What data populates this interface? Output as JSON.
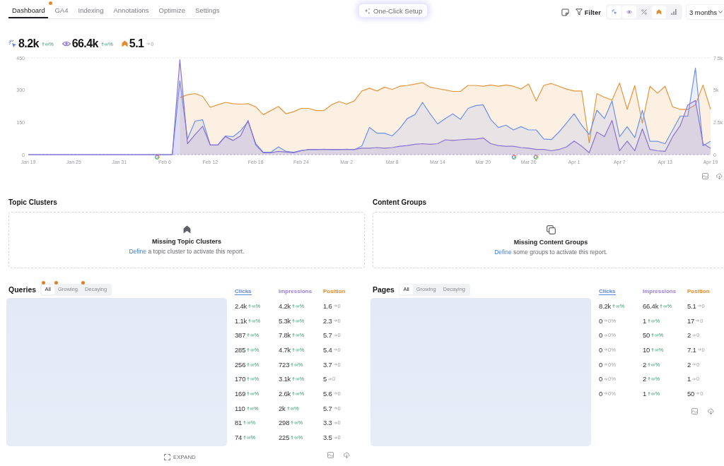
{
  "tabs": [
    {
      "label": "Dashboard",
      "selected": true,
      "dot": false
    },
    {
      "label": "GA4",
      "selected": false,
      "dot": true
    },
    {
      "label": "Indexing",
      "selected": false,
      "dot": false
    },
    {
      "label": "Annotations",
      "selected": false,
      "dot": false
    },
    {
      "label": "Optimize",
      "selected": false,
      "dot": false
    },
    {
      "label": "Settings",
      "selected": false,
      "dot": false
    }
  ],
  "setup_button": {
    "label": "One-Click Setup"
  },
  "toolbar": {
    "filter_label": "Filter",
    "metric_toggles": [
      {
        "kind": "clicks",
        "selected": true
      },
      {
        "kind": "impressions",
        "selected": true
      },
      {
        "kind": "ctr",
        "selected": false
      },
      {
        "kind": "position",
        "selected": true
      },
      {
        "kind": "bars",
        "selected": false
      }
    ],
    "range": "3 months"
  },
  "summary": [
    {
      "kind": "clicks",
      "value": "8.2k",
      "change": "∞%",
      "rising": true
    },
    {
      "kind": "impressions",
      "value": "66.4k",
      "change": "∞%",
      "rising": true
    },
    {
      "kind": "position",
      "value": "5.1",
      "change": "0",
      "rising": false
    }
  ],
  "chart": {
    "chart_data": {
      "type": "area",
      "categories": [
        "Jan 19",
        null,
        null,
        null,
        null,
        null,
        "Jan 25",
        null,
        null,
        null,
        null,
        null,
        "Jan 31",
        null,
        null,
        null,
        null,
        null,
        "Feb 6",
        null,
        null,
        null,
        null,
        null,
        "Feb 12",
        null,
        null,
        null,
        null,
        null,
        "Feb 18",
        null,
        null,
        null,
        null,
        null,
        "Feb 24",
        null,
        null,
        null,
        null,
        null,
        "Mar 2",
        null,
        null,
        null,
        null,
        null,
        "Mar 8",
        null,
        null,
        null,
        null,
        null,
        "Mar 14",
        null,
        null,
        null,
        null,
        null,
        "Mar 20",
        null,
        null,
        null,
        null,
        null,
        "Mar 26",
        null,
        null,
        null,
        null,
        null,
        "Apr 1",
        null,
        null,
        null,
        null,
        null,
        "Apr 7",
        null,
        null,
        null,
        null,
        null,
        "Apr 13",
        null,
        null,
        null,
        null,
        null,
        "Apr 19"
      ],
      "ylim": [
        0,
        450
      ],
      "yticks": [
        0,
        150,
        300,
        450
      ],
      "y2lim": [
        0,
        7500
      ],
      "y2ticks": [
        {
          "value": 0,
          "label": "0"
        },
        {
          "value": 2500,
          "label": "2.5k"
        },
        {
          "value": 5000,
          "label": "5k"
        },
        {
          "value": 7500,
          "label": "7.5k"
        }
      ],
      "series": [
        {
          "color": "#e8953c",
          "values": [
            null,
            null,
            null,
            null,
            null,
            null,
            null,
            null,
            null,
            null,
            null,
            null,
            null,
            null,
            null,
            null,
            null,
            null,
            null,
            null,
            265,
            279,
            284,
            271,
            220,
            232,
            243,
            237,
            235,
            237,
            222,
            186,
            205,
            224,
            190,
            200,
            215,
            215,
            205,
            205,
            232,
            247,
            235,
            250,
            296,
            309,
            296,
            314,
            303,
            318,
            322,
            328,
            335,
            314,
            307,
            301,
            294,
            294,
            322,
            322,
            318,
            324,
            318,
            324,
            318,
            305,
            328,
            250,
            322,
            331,
            318,
            305,
            296,
            296,
            55,
            284,
            267,
            254,
            333,
            211,
            322,
            147,
            318,
            286,
            318,
            222,
            211,
            211,
            232,
            324,
            211
          ]
        },
        {
          "color": "#6f92e8",
          "values": [
            0,
            0,
            0,
            0,
            0,
            0,
            0,
            0,
            0,
            0,
            0,
            0,
            0,
            0,
            0,
            0,
            0,
            0,
            0,
            0,
            343,
            73,
            156,
            162,
            45,
            45,
            87,
            83,
            111,
            154,
            51,
            11,
            11,
            36,
            15,
            11,
            19,
            23,
            23,
            25,
            23,
            23,
            25,
            23,
            40,
            126,
            100,
            100,
            87,
            122,
            168,
            186,
            243,
            190,
            143,
            168,
            190,
            164,
            215,
            228,
            232,
            164,
            126,
            137,
            115,
            130,
            115,
            115,
            73,
            70,
            105,
            147,
            190,
            137,
            94,
            207,
            168,
            250,
            83,
            130,
            79,
            207,
            62,
            62,
            51,
            115,
            179,
            179,
            403,
            41,
            62
          ]
        },
        {
          "color": "#8d72d2",
          "axis": "y2",
          "values": [
            0,
            0,
            0,
            0,
            0,
            0,
            0,
            0,
            0,
            0,
            0,
            0,
            0,
            0,
            0,
            0,
            0,
            0,
            0,
            0,
            7350,
            850,
            1550,
            2200,
            750,
            750,
            1400,
            1100,
            1450,
            2650,
            750,
            150,
            150,
            250,
            200,
            150,
            300,
            400,
            400,
            400,
            400,
            400,
            400,
            400,
            500,
            500,
            550,
            500,
            550,
            650,
            700,
            800,
            850,
            800,
            850,
            1150,
            1100,
            1150,
            1200,
            1200,
            1300,
            850,
            700,
            650,
            650,
            550,
            500,
            400,
            400,
            300,
            400,
            600,
            1050,
            650,
            150,
            1750,
            1400,
            2650,
            300,
            1050,
            300,
            2000,
            400,
            300,
            250,
            1400,
            2250,
            3850,
            4200,
            850,
            500
          ]
        }
      ]
    }
  },
  "cards": [
    {
      "kind": "clusters",
      "title": "Topic Clusters",
      "empty_title": "Missing Topic Clusters",
      "link": "Define",
      "message": "a topic cluster to activate this report."
    },
    {
      "kind": "groups",
      "title": "Content Groups",
      "empty_title": "Missing Content Groups",
      "link": "Define",
      "message": "some groups to activate this report."
    }
  ],
  "panels": [
    {
      "title": "Queries",
      "tabs": [
        {
          "label": "All",
          "selected": true,
          "dot": true
        },
        {
          "label": "Growing",
          "selected": false,
          "dot": true
        },
        {
          "label": "Decaying",
          "selected": false,
          "dot": true
        }
      ],
      "columns": [
        {
          "label": "Clicks",
          "color": "#5a86e6",
          "sorted": true
        },
        {
          "label": "Impressions",
          "color": "#9a7fdc",
          "sorted": false
        },
        {
          "label": "Position",
          "color": "#e38b2f",
          "sorted": false
        }
      ],
      "rows": [
        [
          {
            "value": "2.4k",
            "change": "∞%",
            "rising": true
          },
          {
            "value": "4.2k",
            "change": "∞%",
            "rising": true
          },
          {
            "value": "1.6",
            "change": "0",
            "rising": false
          }
        ],
        [
          {
            "value": "1.1k",
            "change": "∞%",
            "rising": true
          },
          {
            "value": "5.3k",
            "change": "∞%",
            "rising": true
          },
          {
            "value": "2.3",
            "change": "0",
            "rising": false
          }
        ],
        [
          {
            "value": "387",
            "change": "∞%",
            "rising": true
          },
          {
            "value": "7.8k",
            "change": "∞%",
            "rising": true
          },
          {
            "value": "5.7",
            "change": "0",
            "rising": false
          }
        ],
        [
          {
            "value": "285",
            "change": "∞%",
            "rising": true
          },
          {
            "value": "4.7k",
            "change": "∞%",
            "rising": true
          },
          {
            "value": "5.4",
            "change": "0",
            "rising": false
          }
        ],
        [
          {
            "value": "256",
            "change": "∞%",
            "rising": true
          },
          {
            "value": "723",
            "change": "∞%",
            "rising": true
          },
          {
            "value": "3.7",
            "change": "0",
            "rising": false
          }
        ],
        [
          {
            "value": "170",
            "change": "∞%",
            "rising": true
          },
          {
            "value": "3.1k",
            "change": "∞%",
            "rising": true
          },
          {
            "value": "5",
            "change": "0",
            "rising": false
          }
        ],
        [
          {
            "value": "169",
            "change": "∞%",
            "rising": true
          },
          {
            "value": "2.6k",
            "change": "∞%",
            "rising": true
          },
          {
            "value": "5.6",
            "change": "0",
            "rising": false
          }
        ],
        [
          {
            "value": "110",
            "change": "∞%",
            "rising": true
          },
          {
            "value": "2k",
            "change": "∞%",
            "rising": true
          },
          {
            "value": "5.7",
            "change": "0",
            "rising": false
          }
        ],
        [
          {
            "value": "81",
            "change": "∞%",
            "rising": true
          },
          {
            "value": "298",
            "change": "∞%",
            "rising": true
          },
          {
            "value": "3.3",
            "change": "0",
            "rising": false
          }
        ],
        [
          {
            "value": "74",
            "change": "∞%",
            "rising": true
          },
          {
            "value": "225",
            "change": "∞%",
            "rising": true
          },
          {
            "value": "3.5",
            "change": "0",
            "rising": false
          }
        ]
      ],
      "expand_label": "EXPAND"
    },
    {
      "title": "Pages",
      "tabs": [
        {
          "label": "All",
          "selected": true,
          "dot": false
        },
        {
          "label": "Growing",
          "selected": false,
          "dot": false
        },
        {
          "label": "Decaying",
          "selected": false,
          "dot": false
        }
      ],
      "columns": [
        {
          "label": "Clicks",
          "color": "#5a86e6",
          "sorted": true
        },
        {
          "label": "Impressions",
          "color": "#9a7fdc",
          "sorted": false
        },
        {
          "label": "Position",
          "color": "#e38b2f",
          "sorted": false
        }
      ],
      "rows": [
        [
          {
            "value": "8.2k",
            "change": "∞%",
            "rising": true
          },
          {
            "value": "66.4k",
            "change": "∞%",
            "rising": true
          },
          {
            "value": "5.1",
            "change": "0",
            "rising": false
          }
        ],
        [
          {
            "value": "0",
            "change": "0%",
            "rising": false
          },
          {
            "value": "1",
            "change": "∞%",
            "rising": true
          },
          {
            "value": "17",
            "change": "0",
            "rising": false
          }
        ],
        [
          {
            "value": "0",
            "change": "0%",
            "rising": false
          },
          {
            "value": "50",
            "change": "∞%",
            "rising": true
          },
          {
            "value": "2",
            "change": "0",
            "rising": false
          }
        ],
        [
          {
            "value": "0",
            "change": "0%",
            "rising": false
          },
          {
            "value": "10",
            "change": "∞%",
            "rising": true
          },
          {
            "value": "7.1",
            "change": "0",
            "rising": false
          }
        ],
        [
          {
            "value": "0",
            "change": "0%",
            "rising": false
          },
          {
            "value": "2",
            "change": "∞%",
            "rising": true
          },
          {
            "value": "2",
            "change": "0",
            "rising": false
          }
        ],
        [
          {
            "value": "0",
            "change": "0%",
            "rising": false
          },
          {
            "value": "2",
            "change": "∞%",
            "rising": true
          },
          {
            "value": "1",
            "change": "0",
            "rising": false
          }
        ],
        [
          {
            "value": "0",
            "change": "0%",
            "rising": false
          },
          {
            "value": "1",
            "change": "∞%",
            "rising": true
          },
          {
            "value": "50",
            "change": "0",
            "rising": false
          }
        ]
      ]
    }
  ]
}
